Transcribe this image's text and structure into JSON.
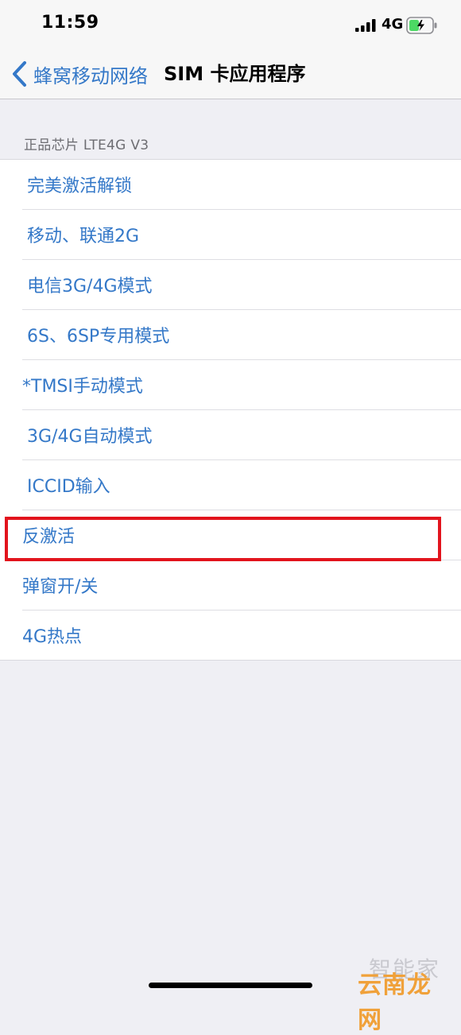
{
  "status_bar": {
    "time": "11:59",
    "network": "4G",
    "signal_icon": "cellular-signal-icon",
    "battery_icon": "battery-charging-icon",
    "battery_color": "#4cd964"
  },
  "nav": {
    "back_label": "蜂窝移动网络",
    "back_icon": "chevron-left-icon",
    "title": "SIM 卡应用程序",
    "accent_color": "#3478c8"
  },
  "section": {
    "header": "正品芯片 LTE4G V3"
  },
  "items": [
    {
      "label": "完美激活解锁"
    },
    {
      "label": "移动、联通2G"
    },
    {
      "label": "电信3G/4G模式"
    },
    {
      "label": "6S、6SP专用模式"
    },
    {
      "label": "*TMSI手动模式"
    },
    {
      "label": "3G/4G自动模式"
    },
    {
      "label": "ICCID输入"
    },
    {
      "label": "反激活"
    },
    {
      "label": "弹窗开/关"
    },
    {
      "label": "4G热点"
    }
  ],
  "highlight": {
    "color": "#e2141d",
    "target": "反激活"
  },
  "watermark": {
    "top_text": "智能家",
    "bottom_text": "云南龙网",
    "bottom_color": "#f0a13a"
  }
}
